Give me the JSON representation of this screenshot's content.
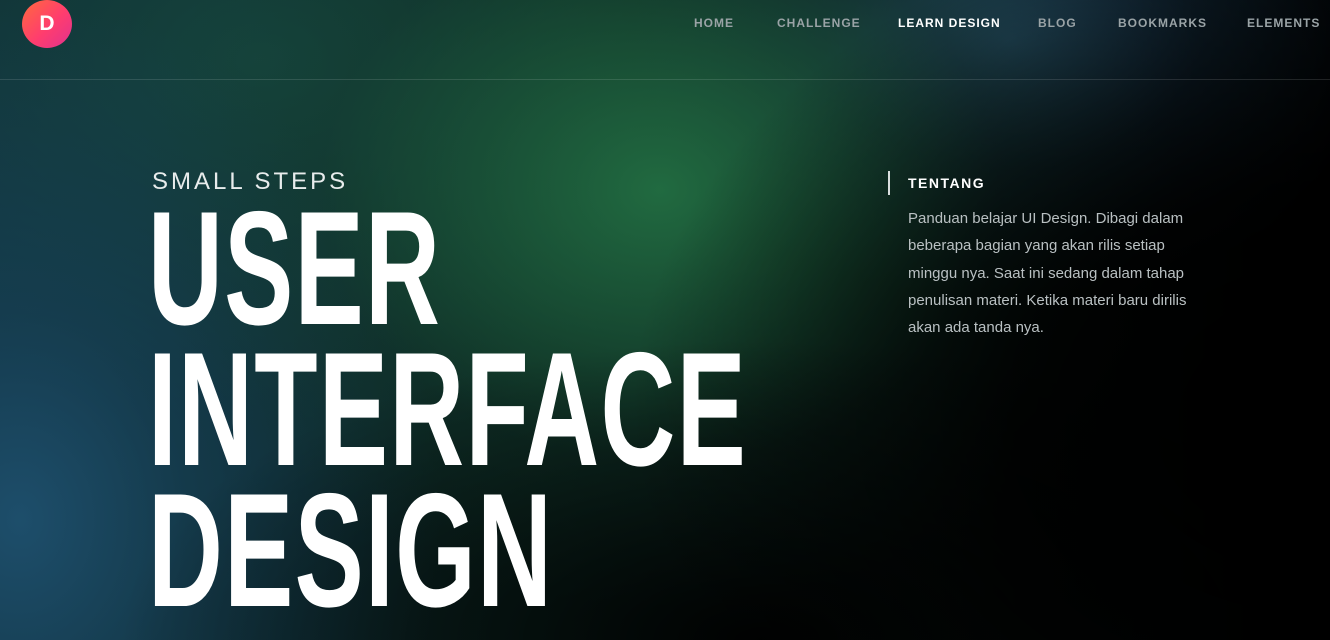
{
  "header": {
    "logo_letter": "D",
    "nav": [
      {
        "label": "HOME",
        "active": false
      },
      {
        "label": "CHALLENGE",
        "active": false
      },
      {
        "label": "LEARN DESIGN",
        "active": true
      },
      {
        "label": "BLOG",
        "active": false
      },
      {
        "label": "BOOKMARKS",
        "active": false
      },
      {
        "label": "ELEMENTS",
        "active": false
      }
    ]
  },
  "hero": {
    "eyebrow": "SMALL STEPS",
    "headline": [
      "USER",
      "INTERFACE",
      "DESIGN"
    ]
  },
  "about": {
    "title": "TENTANG",
    "text": "Panduan belajar UI Design. Dibagi dalam beberapa bagian yang akan rilis setiap minggu nya. Saat ini sedang dalam tahap penulisan materi. Ketika materi baru dirilis akan ada tanda nya."
  },
  "colors": {
    "logo_gradient_start": "#ff6a3d",
    "logo_gradient_end": "#e0328f",
    "nav_inactive": "#9aa3a6",
    "nav_active": "#ffffff",
    "body_text": "#b9c0c2"
  }
}
